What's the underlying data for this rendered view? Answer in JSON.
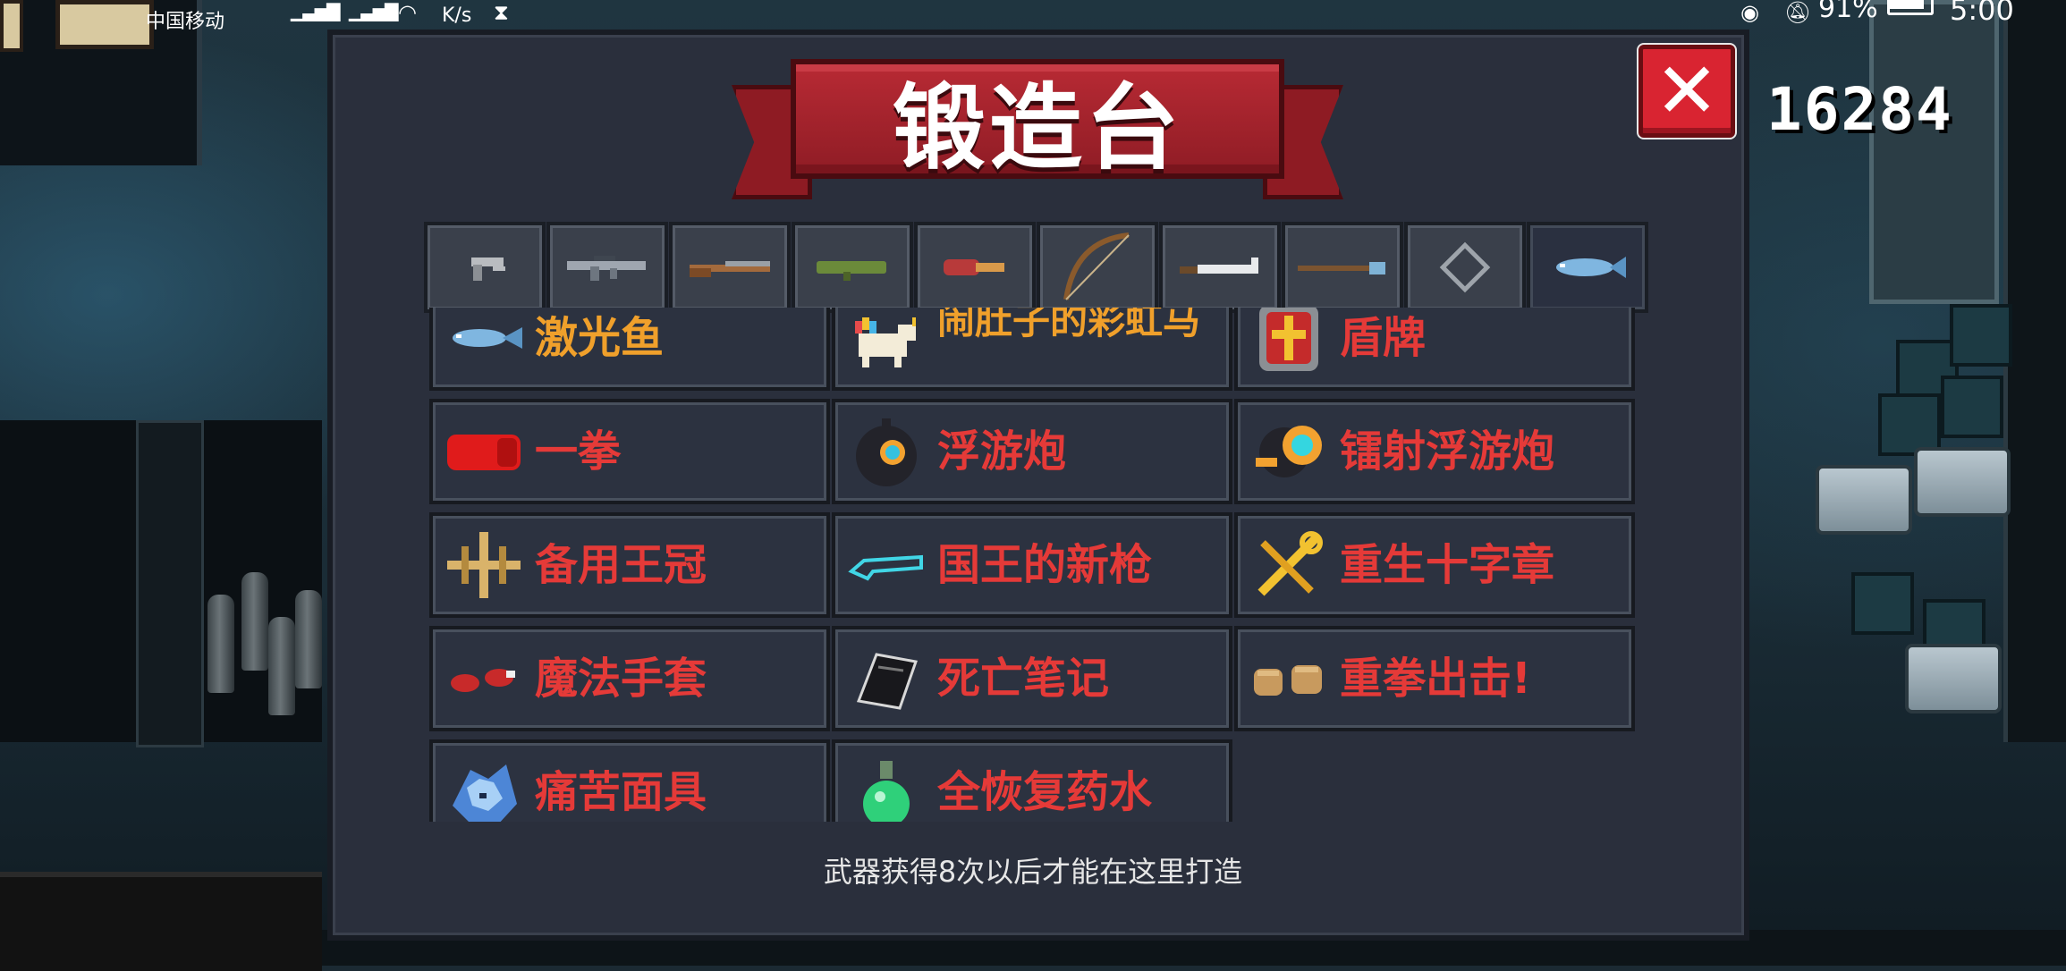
{
  "status_bar": {
    "carrier": "中国移动",
    "net_speed_unit": "K/s",
    "battery_percent": "91%",
    "battery_level": 0.91,
    "time": "5:00"
  },
  "gems": {
    "count": "16284"
  },
  "forge": {
    "title": "锻造台",
    "close_label": "✕",
    "categories": [
      {
        "icon": "pistol-icon"
      },
      {
        "icon": "assault-rifle-icon"
      },
      {
        "icon": "shotgun-icon"
      },
      {
        "icon": "rocket-launcher-icon"
      },
      {
        "icon": "flamethrower-icon"
      },
      {
        "icon": "bow-icon"
      },
      {
        "icon": "sword-icon"
      },
      {
        "icon": "spear-icon"
      },
      {
        "icon": "shuriken-icon"
      },
      {
        "icon": "fish-icon",
        "active": true
      }
    ],
    "items": [
      {
        "name": "激光鱼",
        "color": "#f0a02b",
        "icon": "laser-fish-icon"
      },
      {
        "name": "闹肚子的彩虹马",
        "color": "#f0a02b",
        "icon": "rainbow-unicorn-icon"
      },
      {
        "name": "盾牌",
        "color": "#e53a38",
        "icon": "shield-icon"
      },
      {
        "name": "一拳",
        "color": "#e53a38",
        "icon": "red-fist-icon"
      },
      {
        "name": "浮游炮",
        "color": "#e53a38",
        "icon": "floating-cannon-icon"
      },
      {
        "name": "镭射浮游炮",
        "color": "#e53a38",
        "icon": "laser-floating-cannon-icon"
      },
      {
        "name": "备用王冠",
        "color": "#e53a38",
        "icon": "spare-crown-icon"
      },
      {
        "name": "国王的新枪",
        "color": "#e53a38",
        "icon": "invisible-gun-icon"
      },
      {
        "name": "重生十字章",
        "color": "#e53a38",
        "icon": "rebirth-cross-icon"
      },
      {
        "name": "魔法手套",
        "color": "#e53a38",
        "icon": "magic-gloves-icon"
      },
      {
        "name": "死亡笔记",
        "color": "#e53a38",
        "icon": "death-note-icon"
      },
      {
        "name": "重拳出击!",
        "color": "#e53a38",
        "icon": "heavy-punch-icon"
      },
      {
        "name": "痛苦面具",
        "color": "#e53a38",
        "icon": "pain-mask-icon"
      },
      {
        "name": "全恢复药水",
        "color": "#e53a38",
        "icon": "full-heal-potion-icon"
      }
    ],
    "footer_note": "武器获得8次以后才能在这里打造"
  }
}
